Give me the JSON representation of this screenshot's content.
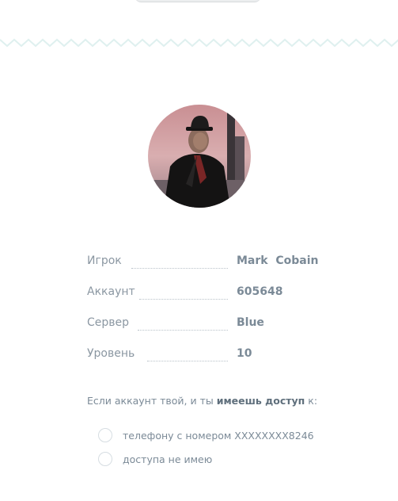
{
  "player": {
    "avatar_icon": "character-avatar-icon",
    "rows": [
      {
        "label": "Игрок",
        "value": "Mark  Cobain"
      },
      {
        "label": "Аккаунт",
        "value": "605648"
      },
      {
        "label": "Сервер",
        "value": "Blue"
      },
      {
        "label": "Уровень",
        "value": "10"
      }
    ]
  },
  "access": {
    "prefix": "Если аккаунт твой, и ты ",
    "emphasis": "имеешь доступ",
    "suffix": " к:",
    "options": [
      {
        "label": "телефону с номером XXXXXXXX8246",
        "selected": false
      },
      {
        "label": "доступа не имею",
        "selected": false
      }
    ]
  },
  "colors": {
    "accent_zigzag": "#dff0ef",
    "text": "#7b8a97"
  }
}
